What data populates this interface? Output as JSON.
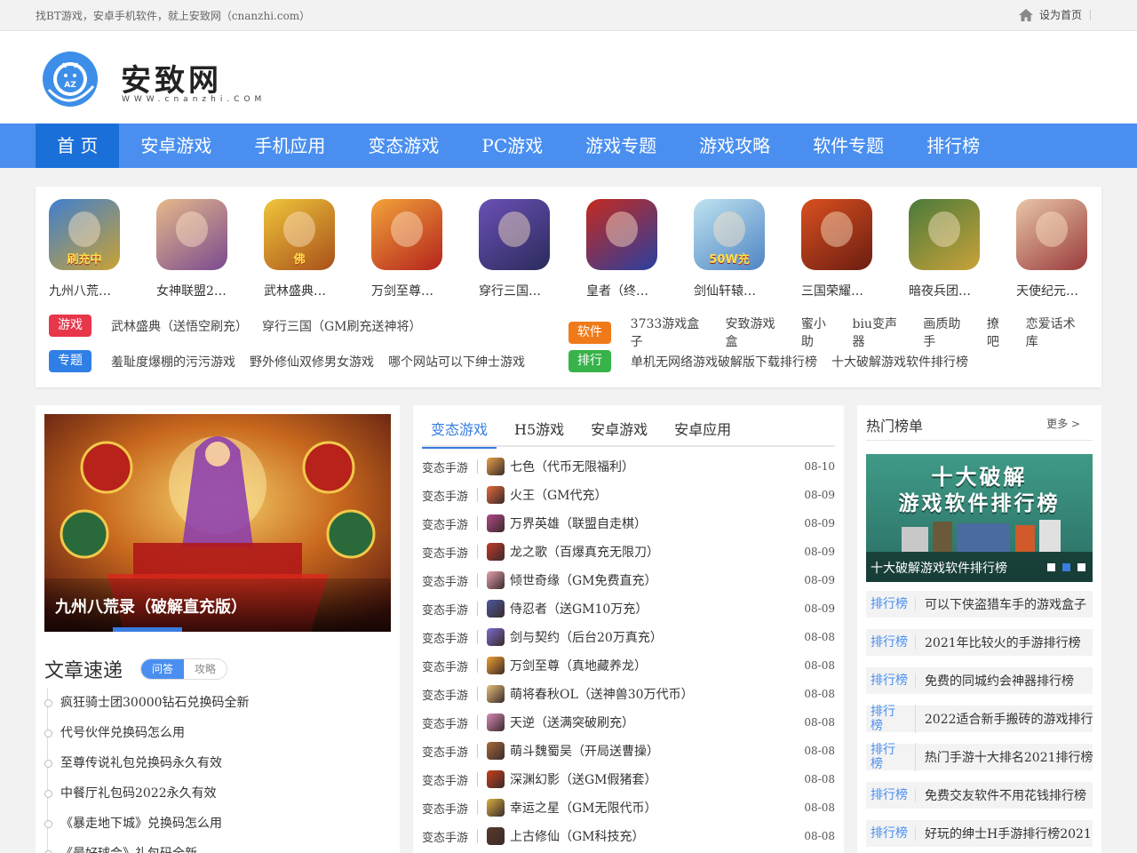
{
  "topbar": {
    "slogan": "找BT游戏，安卓手机软件，就上安致网（cnanzhi.com）",
    "set_home": "设为首页"
  },
  "logo": {
    "title": "安致网",
    "sub": "WWW.cnanzhi.COM",
    "badge": "AZ"
  },
  "nav": [
    "首 页",
    "安卓游戏",
    "手机应用",
    "变态游戏",
    "PC游戏",
    "游戏专题",
    "游戏攻略",
    "软件专题",
    "排行榜"
  ],
  "apps": [
    {
      "name": "九州八荒…",
      "badge": "刷充中",
      "c1": "#3f7fd0",
      "c2": "#caa233"
    },
    {
      "name": "女神联盟2…",
      "badge": "",
      "c1": "#e6b98a",
      "c2": "#7a4a8f"
    },
    {
      "name": "武林盛典…",
      "badge": "佛",
      "c1": "#f0c53a",
      "c2": "#a8501a"
    },
    {
      "name": "万剑至尊…",
      "badge": "",
      "c1": "#f2a33a",
      "c2": "#b4231c"
    },
    {
      "name": "穿行三国…",
      "badge": "",
      "c1": "#6a50b5",
      "c2": "#2b2b5c"
    },
    {
      "name": "皇者（终…",
      "badge": "",
      "c1": "#c52a1e",
      "c2": "#2a3fa0"
    },
    {
      "name": "剑仙轩辕…",
      "badge": "50W充",
      "c1": "#bfe3f0",
      "c2": "#4e84c4"
    },
    {
      "name": "三国荣耀…",
      "badge": "",
      "c1": "#d9501f",
      "c2": "#6b1d12"
    },
    {
      "name": "暗夜兵团…",
      "badge": "",
      "c1": "#4a7a3a",
      "c2": "#c9a23a"
    },
    {
      "name": "天使纪元…",
      "badge": "",
      "c1": "#e8c6a8",
      "c2": "#9a3b3b"
    }
  ],
  "tag_rows": [
    {
      "tag": "游戏",
      "color": "#e8364a",
      "links": [
        "武林盛典（送悟空刷充）",
        "穿行三国（GM刷充送神将）"
      ]
    },
    {
      "tag": "软件",
      "color": "#f07a1a",
      "links": [
        "3733游戏盒子",
        "安致游戏盒",
        "蜜小助",
        "biu变声器",
        "画质助手",
        "撩吧",
        "恋爱话术库"
      ]
    },
    {
      "tag": "专题",
      "color": "#2f7fe6",
      "links": [
        "羞耻度爆棚的污污游戏",
        "野外修仙双修男女游戏",
        "哪个网站可以下绅士游戏"
      ]
    },
    {
      "tag": "排行",
      "color": "#37b34a",
      "links": [
        "单机无网络游戏破解版下载排行榜",
        "十大破解游戏软件排行榜"
      ]
    }
  ],
  "banner": {
    "caption": "九州八荒录（破解直充版）"
  },
  "articles": {
    "title": "文章速递",
    "tabs": [
      "问答",
      "攻略"
    ],
    "items": [
      "疯狂骑士团30000钻石兑换码全新",
      "代号伙伴兑换码怎么用",
      "至尊传说礼包兑换码永久有效",
      "中餐厅礼包码2022永久有效",
      "《暴走地下城》兑换码怎么用",
      "《最好球会》礼包码全新"
    ]
  },
  "games": {
    "tabs": [
      "变态游戏",
      "H5游戏",
      "安卓游戏",
      "安卓应用"
    ],
    "rows": [
      {
        "cat": "变态手游",
        "name": "七色（代币无限福利）",
        "date": "08-10",
        "color": "#e8a24a"
      },
      {
        "cat": "变态手游",
        "name": "火王（GM代充）",
        "date": "08-09",
        "color": "#e36a3a"
      },
      {
        "cat": "变态手游",
        "name": "万界英雄（联盟自走棋）",
        "date": "08-09",
        "color": "#b04a8a"
      },
      {
        "cat": "变态手游",
        "name": "龙之歌（百爆真充无限刀）",
        "date": "08-09",
        "color": "#c23a2a"
      },
      {
        "cat": "变态手游",
        "name": "倾世奇缘（GM免费直充）",
        "date": "08-09",
        "color": "#e6a0b0"
      },
      {
        "cat": "变态手游",
        "name": "侍忍者（送GM10万充）",
        "date": "08-09",
        "color": "#4a5aa0"
      },
      {
        "cat": "变态手游",
        "name": "剑与契约（后台20万真充）",
        "date": "08-08",
        "color": "#7a6ad0"
      },
      {
        "cat": "变态手游",
        "name": "万剑至尊（真地藏养龙）",
        "date": "08-08",
        "color": "#f0a030"
      },
      {
        "cat": "变态手游",
        "name": "萌将春秋OL（送神兽30万代币）",
        "date": "08-08",
        "color": "#e7c07a"
      },
      {
        "cat": "变态手游",
        "name": "天逆（送满突破刷充）",
        "date": "08-08",
        "color": "#d88ab8"
      },
      {
        "cat": "变态手游",
        "name": "萌斗魏蜀吴（开局送曹操）",
        "date": "08-08",
        "color": "#a86a3a"
      },
      {
        "cat": "变态手游",
        "name": "深渊幻影（送GM假猪套）",
        "date": "08-08",
        "color": "#c8401a"
      },
      {
        "cat": "变态手游",
        "name": "幸运之星（GM无限代币）",
        "date": "08-08",
        "color": "#d8b040"
      },
      {
        "cat": "变态手游",
        "name": "上古修仙（GM科技充）",
        "date": "08-08",
        "color": "#5a3a2a"
      }
    ]
  },
  "ranking": {
    "title": "热门榜单",
    "more": "更多 >",
    "banner_line1": "十大破解",
    "banner_line2": "游戏软件排行榜",
    "banner_caption": "十大破解游戏软件排行榜",
    "badge": "排行榜",
    "items": [
      "可以下侠盗猎车手的游戏盒子",
      "2021年比较火的手游排行榜",
      "免费的同城约会神器排行榜",
      "2022适合新手搬砖的游戏排行",
      "热门手游十大排名2021排行榜",
      "免费交友软件不用花钱排行榜",
      "好玩的绅士H手游排行榜2021"
    ]
  }
}
